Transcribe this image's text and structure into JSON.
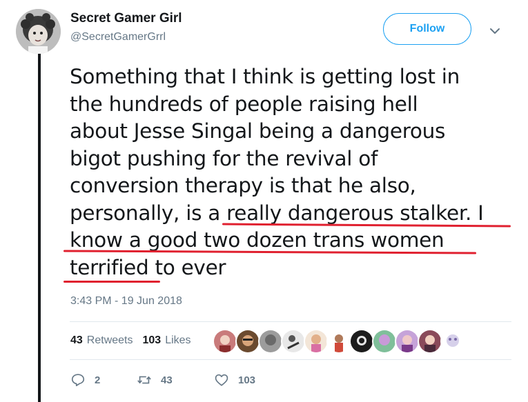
{
  "user": {
    "name": "Secret Gamer Girl",
    "handle": "@SecretGamerGrrl"
  },
  "follow_label": "Follow",
  "tweet": {
    "lines": [
      "Something that I think is getting lost in",
      "the hundreds of people raising hell",
      "about Jesse Singal being a dangerous",
      "bigot pushing for the revival of",
      "conversion therapy is that he also,",
      "personally, is a really dangerous stalker. I",
      "know a good two dozen trans women",
      "terrified to ever"
    ]
  },
  "timestamp": "3:43 PM - 19 Jun 2018",
  "stats": {
    "retweets_count": "43",
    "retweets_label": "Retweets",
    "likes_count": "103",
    "likes_label": "Likes"
  },
  "actions": {
    "reply_count": "2",
    "retweet_count": "43",
    "like_count": "103"
  },
  "icons": {
    "caret": "chevron-down-icon",
    "reply": "reply-icon",
    "retweet": "retweet-icon",
    "like": "heart-icon"
  },
  "colors": {
    "accent": "#1da1f2",
    "annotation": "#e0202f",
    "muted": "#657786"
  }
}
